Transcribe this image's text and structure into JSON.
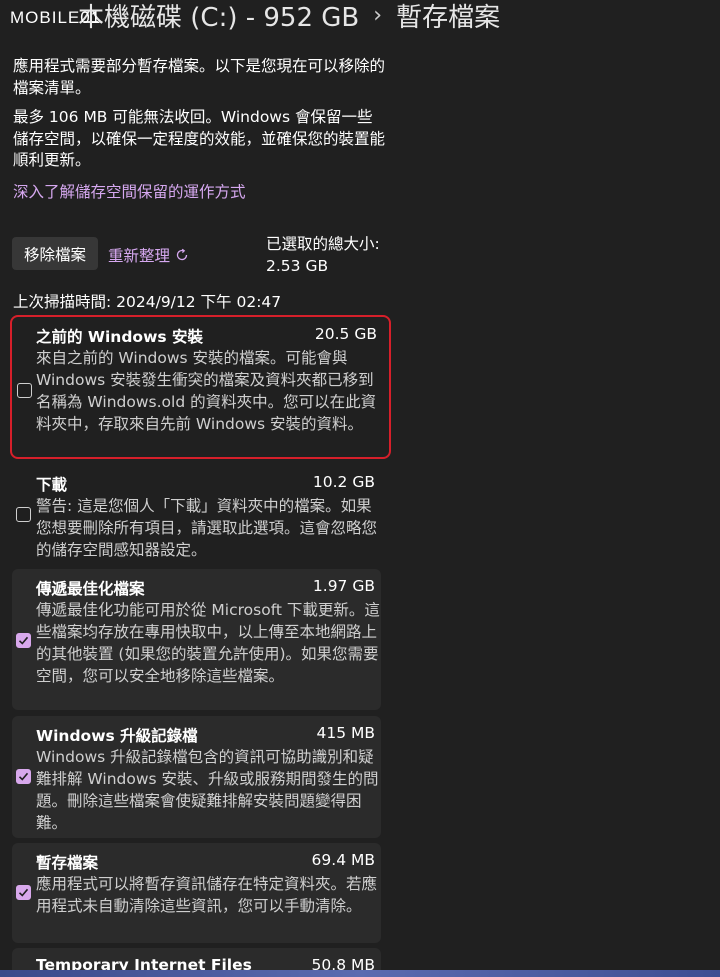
{
  "watermark": "MOBILE01",
  "breadcrumb": {
    "drive": "本機磁碟 (C:) - 952 GB",
    "current": "暫存檔案"
  },
  "intro": {
    "line1": "應用程式需要部分暫存檔案。以下是您現在可以移除的檔案清單。",
    "line2": "最多 106 MB 可能無法收回。Windows 會保留一些儲存空間，以確保一定程度的效能，並確保您的裝置能順利更新。",
    "learn_more": "深入了解儲存空間保留的運作方式"
  },
  "toolbar": {
    "remove_label": "移除檔案",
    "refresh_label": "重新整理",
    "selected_total_label": "已選取的總大小:",
    "selected_total_value": "2.53 GB"
  },
  "last_scan": "上次掃描時間: 2024/9/12 下午 02:47",
  "items": [
    {
      "title": "之前的 Windows 安裝",
      "size": "20.5 GB",
      "description": "來自之前的 Windows 安裝的檔案。可能會與 Windows 安裝發生衝突的檔案及資料夾都已移到名稱為 Windows.old 的資料夾中。您可以在此資料夾中，存取來自先前 Windows 安裝的資料。",
      "checked": false
    },
    {
      "title": "下載",
      "size": "10.2 GB",
      "description": "警告: 這是您個人「下載」資料夾中的檔案。如果您想要刪除所有項目，請選取此選項。這會忽略您的儲存空間感知器設定。",
      "checked": false
    },
    {
      "title": "傳遞最佳化檔案",
      "size": "1.97 GB",
      "description": "傳遞最佳化功能可用於從 Microsoft 下載更新。這些檔案均存放在專用快取中，以上傳至本地網路上的其他裝置 (如果您的裝置允許使用)。如果您需要空間，您可以安全地移除這些檔案。",
      "checked": true
    },
    {
      "title": "Windows 升級記錄檔",
      "size": "415 MB",
      "description": "Windows 升級記錄檔包含的資訊可協助識別和疑難排解 Windows 安裝、升級或服務期間發生的問題。刪除這些檔案會使疑難排解安裝問題變得困難。",
      "checked": true
    },
    {
      "title": "暫存檔案",
      "size": "69.4 MB",
      "description": "應用程式可以將暫存資訊儲存在特定資料夾。若應用程式未自動清除這些資訊，您可以手動清除。",
      "checked": true
    },
    {
      "title": "Temporary Internet Files",
      "size": "50.8 MB",
      "description": "",
      "checked": false
    }
  ],
  "colors": {
    "background": "#202020",
    "accent": "#d8a8ec",
    "highlight_border": "#d61f2a"
  }
}
